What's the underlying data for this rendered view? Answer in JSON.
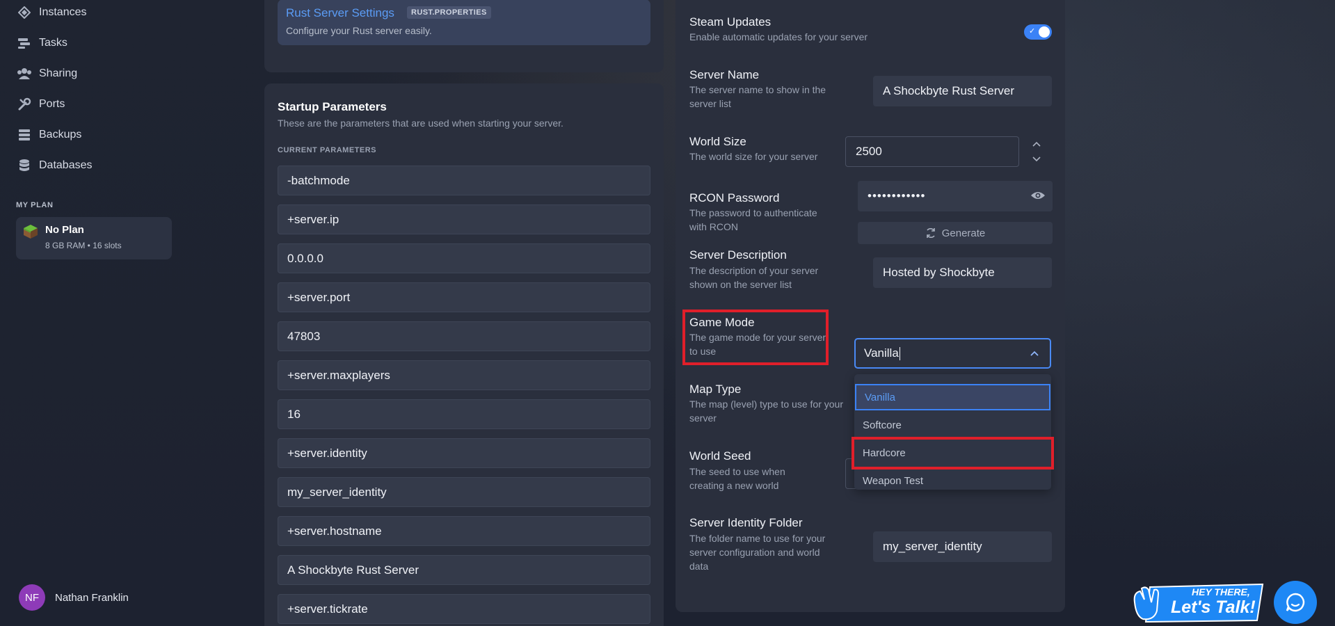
{
  "sidebar": {
    "nav": [
      {
        "label": "Instances",
        "icon": "instances-icon"
      },
      {
        "label": "Tasks",
        "icon": "tasks-icon"
      },
      {
        "label": "Sharing",
        "icon": "sharing-icon"
      },
      {
        "label": "Ports",
        "icon": "ports-icon"
      },
      {
        "label": "Backups",
        "icon": "backups-icon"
      },
      {
        "label": "Databases",
        "icon": "databases-icon"
      }
    ],
    "plan_section": "MY PLAN",
    "plan": {
      "name": "No Plan",
      "meta": "8 GB RAM • 16 slots"
    },
    "user": {
      "initials": "NF",
      "name": "Nathan Franklin"
    }
  },
  "settings_link": {
    "title": "Rust Server Settings",
    "tag": "RUST.PROPERTIES",
    "desc": "Configure your Rust server easily."
  },
  "startup": {
    "title": "Startup Parameters",
    "desc": "These are the parameters that are used when starting your server.",
    "current_label": "CURRENT PARAMETERS",
    "params": [
      "-batchmode",
      "+server.ip",
      "0.0.0.0",
      "+server.port",
      "47803",
      "+server.maxplayers",
      "16",
      "+server.identity",
      "my_server_identity",
      "+server.hostname",
      "A Shockbyte Rust Server",
      "+server.tickrate"
    ]
  },
  "settings": {
    "steam_updates": {
      "title": "Steam Updates",
      "desc": "Enable automatic updates for your server",
      "enabled": true
    },
    "server_name": {
      "title": "Server Name",
      "desc_1": "The server name to show in the",
      "desc_2": "server list",
      "value": "A Shockbyte Rust Server"
    },
    "world_size": {
      "title": "World Size",
      "desc": "The world size for your server",
      "value": "2500"
    },
    "rcon_password": {
      "title": "RCON Password",
      "desc_1": "The password to authenticate",
      "desc_2": "with RCON",
      "value": "••••••••••••",
      "generate_label": "Generate"
    },
    "server_description": {
      "title": "Server Description",
      "desc_1": "The description of your server",
      "desc_2": "shown on the server list",
      "value": "Hosted by Shockbyte"
    },
    "game_mode": {
      "title": "Game Mode",
      "desc_1": "The game mode for your server",
      "desc_2": "to use",
      "value": "Vanilla",
      "options": [
        "Vanilla",
        "Softcore",
        "Hardcore",
        "Weapon Test"
      ]
    },
    "map_type": {
      "title": "Map Type",
      "desc_1": "The map (level) type to use for your",
      "desc_2": "server"
    },
    "world_seed": {
      "title": "World Seed",
      "desc_1": "The seed to use when",
      "desc_2": "creating a new world"
    },
    "identity_folder": {
      "title": "Server Identity Folder",
      "desc_1": "The folder name to use for your",
      "desc_2": "server configuration and world",
      "desc_3": "data",
      "value": "my_server_identity"
    }
  },
  "chat": {
    "line1": "HEY THERE,",
    "line2": "Let's Talk!"
  },
  "colors": {
    "accent": "#3b82f6",
    "highlight": "#e01f2a",
    "avatar": "#8e3bb8"
  }
}
